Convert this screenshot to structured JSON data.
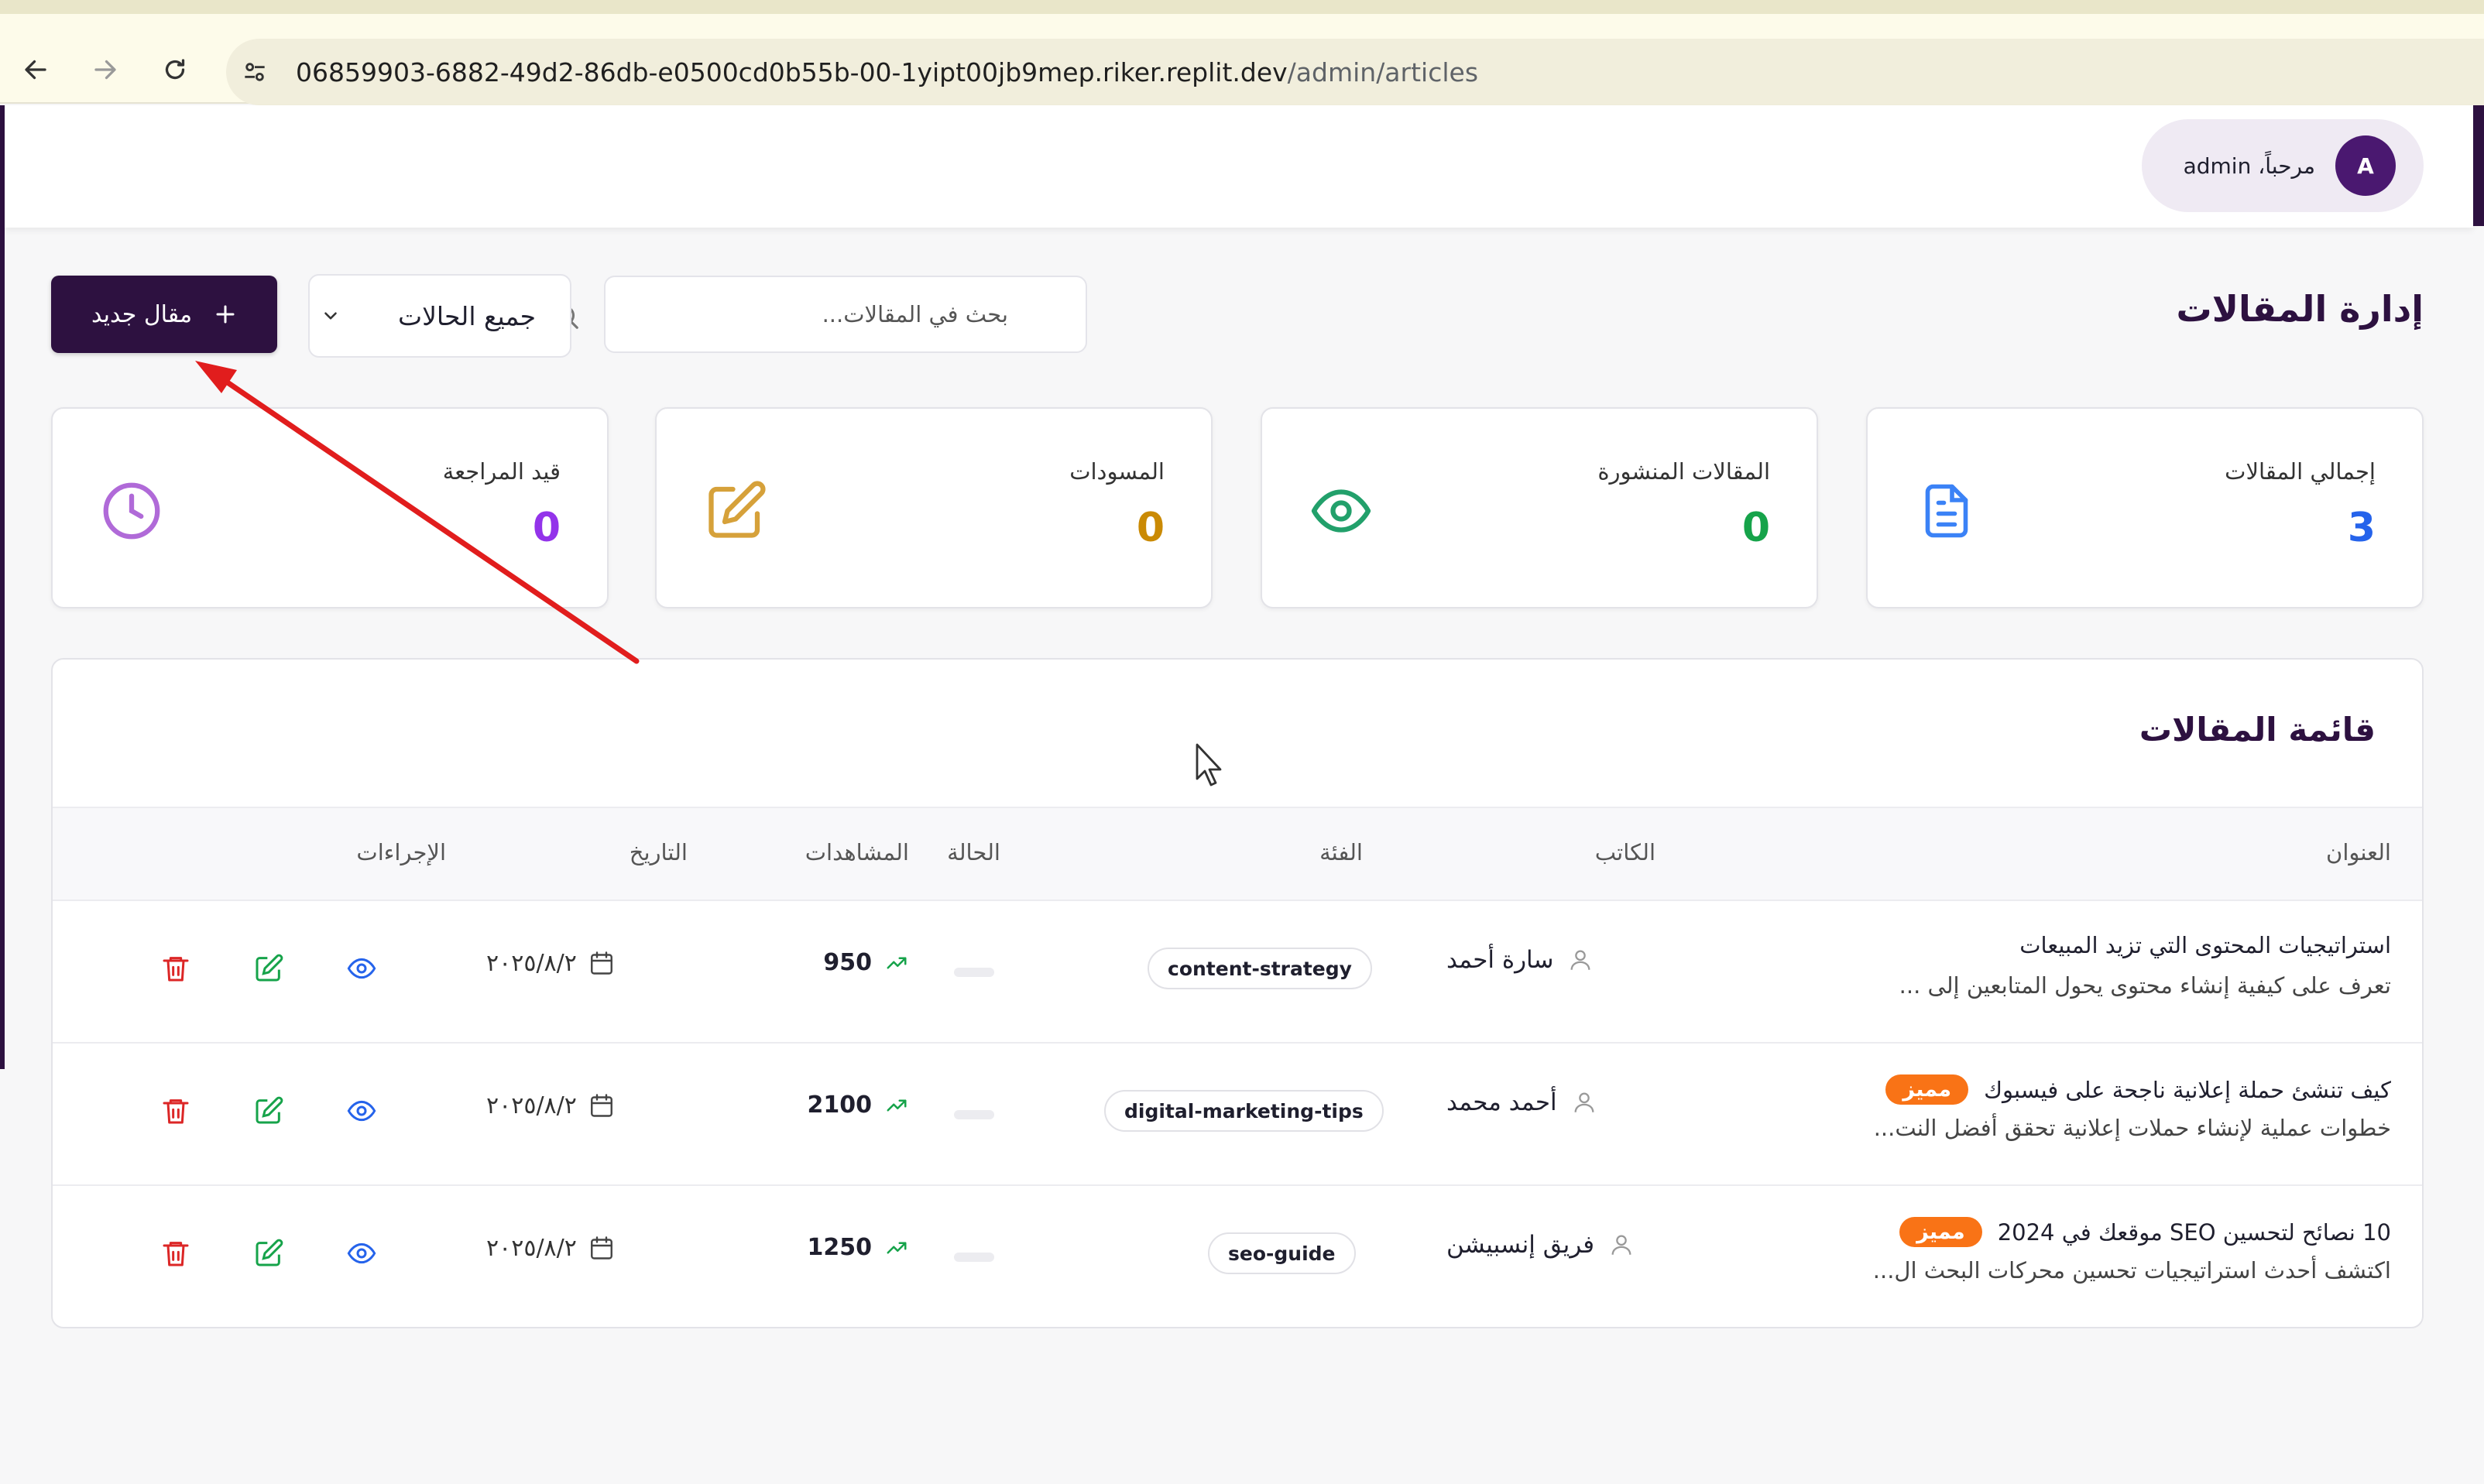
{
  "browser": {
    "url_host": "06859903-6882-49d2-86db-e0500cd0b55b-00-1yipt00jb9mep.riker.replit.dev",
    "url_path": "/admin/articles"
  },
  "header": {
    "greeting": "مرحباً، admin",
    "avatar_letter": "A"
  },
  "page": {
    "title": "إدارة المقالات",
    "search_placeholder": "بحث في المقالات...",
    "status_filter": "جميع الحالات",
    "new_article_label": "مقال جديد"
  },
  "stats": [
    {
      "label": "إجمالي المقالات",
      "value": "3",
      "color": "#2563eb",
      "icon": "document-icon"
    },
    {
      "label": "المقالات المنشورة",
      "value": "0",
      "color": "#16a34a",
      "icon": "eye-icon"
    },
    {
      "label": "المسودات",
      "value": "0",
      "color": "#ca8a04",
      "icon": "edit-icon"
    },
    {
      "label": "قيد المراجعة",
      "value": "0",
      "color": "#9333ea",
      "icon": "clock-icon"
    }
  ],
  "table": {
    "title": "قائمة المقالات",
    "headers": {
      "title": "العنوان",
      "author": "الكاتب",
      "category": "الفئة",
      "status": "الحالة",
      "views": "المشاهدات",
      "date": "التاريخ",
      "actions": "الإجراءات"
    },
    "rows": [
      {
        "title": "استراتيجيات المحتوى التي تزيد المبيعات",
        "excerpt": "تعرف على كيفية إنشاء محتوى يحول المتابعين إلى ...",
        "featured": "",
        "author": "سارة أحمد",
        "category": "content-strategy",
        "views": "950",
        "date": "٢٠٢٥/٨/٢"
      },
      {
        "title": "كيف تنشئ حملة إعلانية ناجحة على فيسبوك",
        "excerpt": "خطوات عملية لإنشاء حملات إعلانية تحقق أفضل النت...",
        "featured": "مميز",
        "author": "أحمد محمد",
        "category": "digital-marketing-tips",
        "views": "2100",
        "date": "٢٠٢٥/٨/٢"
      },
      {
        "title": "10 نصائح لتحسين SEO موقعك في 2024",
        "excerpt": "اكتشف أحدث استراتيجيات تحسين محركات البحث ال...",
        "featured": "مميز",
        "author": "فريق إنسبيشن",
        "category": "seo-guide",
        "views": "1250",
        "date": "٢٠٢٥/٨/٢"
      }
    ]
  },
  "colors": {
    "brand": "#2d1140",
    "featured": "#f97316",
    "view_action": "#2563eb",
    "edit_action": "#16a34a",
    "delete_action": "#dc2626",
    "trend": "#16a34a",
    "annotation_arrow": "#e11d1d"
  }
}
